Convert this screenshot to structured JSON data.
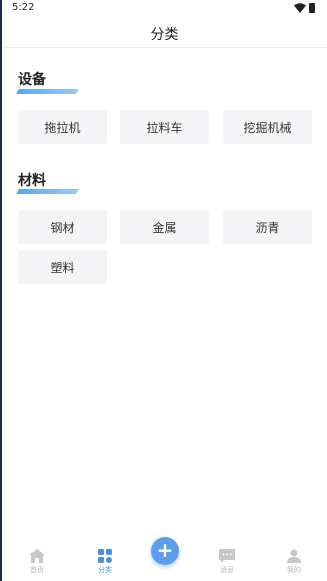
{
  "status_bar": {
    "time": "5:22"
  },
  "header": {
    "title": "分类"
  },
  "sections": [
    {
      "title": "设备",
      "items": [
        "拖拉机",
        "拉料车",
        "挖掘机械"
      ]
    },
    {
      "title": "材料",
      "items": [
        "钢材",
        "金属",
        "沥青",
        "塑料"
      ]
    }
  ],
  "tabbar": {
    "tabs": [
      {
        "label": "首页",
        "icon": "home-icon"
      },
      {
        "label": "分类",
        "icon": "category-icon",
        "active": true
      },
      {
        "label": "消息",
        "icon": "message-icon"
      },
      {
        "label": "我的",
        "icon": "user-icon"
      }
    ],
    "publish_icon": "plus-icon",
    "publish_label": "+"
  },
  "colors": {
    "accent": "#4a90e2",
    "chip_bg": "#f4f4f6",
    "inactive": "#b5b5b5"
  }
}
